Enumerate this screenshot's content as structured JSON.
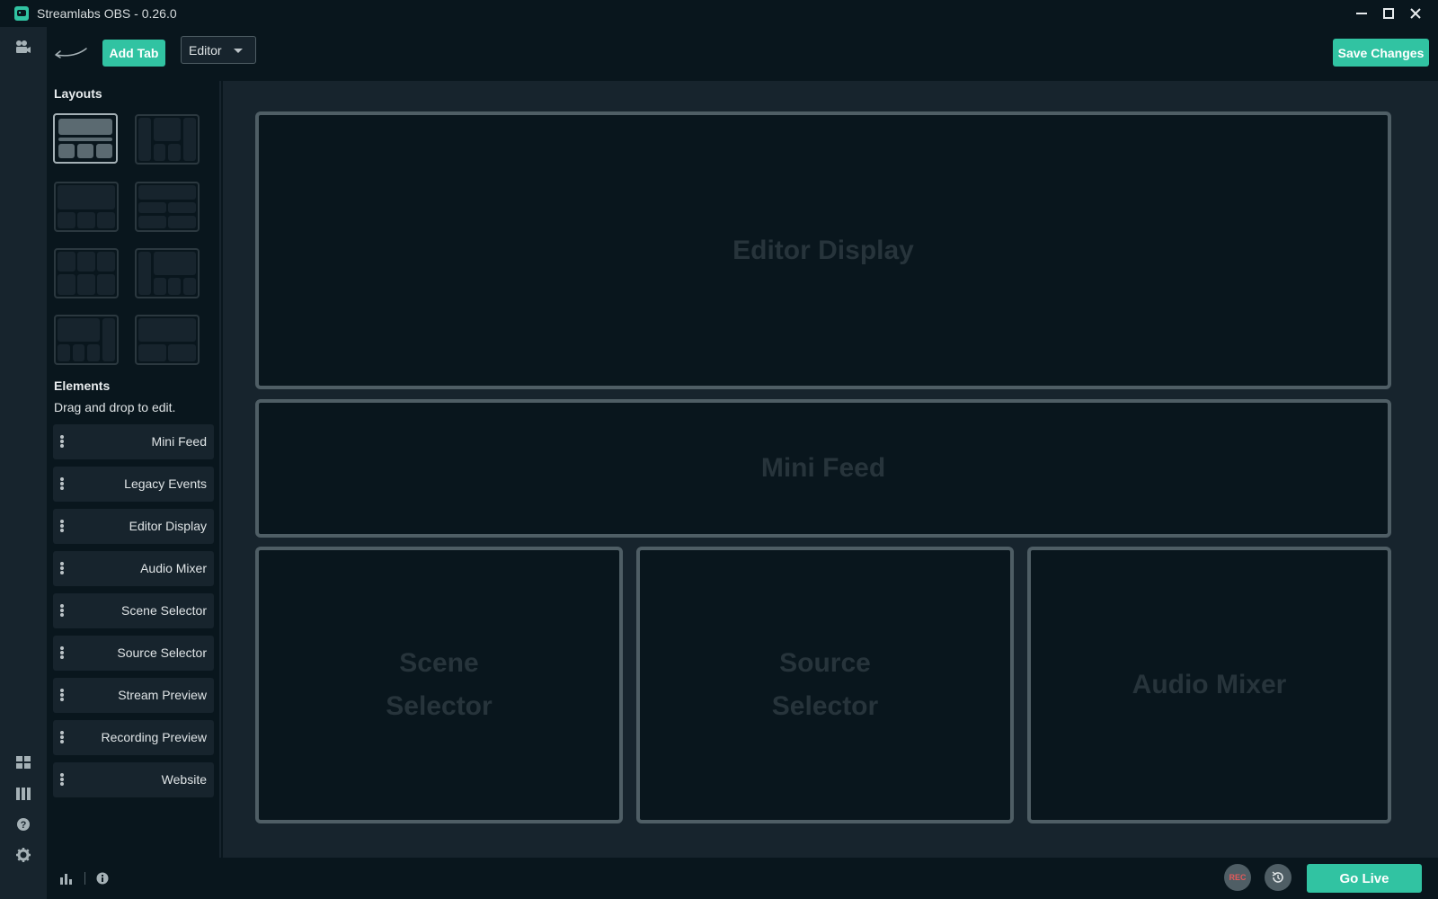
{
  "window": {
    "title": "Streamlabs OBS - 0.26.0"
  },
  "toolbar": {
    "add_tab_label": "Add Tab",
    "editor_select_value": "Editor",
    "save_changes_label": "Save Changes"
  },
  "sidebar": {
    "layouts_title": "Layouts",
    "elements_title": "Elements",
    "elements_hint": "Drag and drop to edit.",
    "elements": [
      {
        "label": "Mini Feed"
      },
      {
        "label": "Legacy Events"
      },
      {
        "label": "Editor Display"
      },
      {
        "label": "Audio Mixer"
      },
      {
        "label": "Scene Selector"
      },
      {
        "label": "Source Selector"
      },
      {
        "label": "Stream Preview"
      },
      {
        "label": "Recording Preview"
      },
      {
        "label": "Website"
      }
    ]
  },
  "canvas": {
    "slots": [
      {
        "label": "Editor Display"
      },
      {
        "label": "Mini Feed"
      },
      {
        "label": "Scene\nSelector"
      },
      {
        "label": "Source\nSelector"
      },
      {
        "label": "Audio Mixer"
      }
    ]
  },
  "footer": {
    "rec_label": "REC",
    "go_live_label": "Go Live"
  },
  "colors": {
    "accent": "#31c3a2",
    "background": "#09161d",
    "panel": "#17242d",
    "border": "#4f5e65",
    "rec_red": "#e35a5a"
  },
  "icons": {
    "app": "streamlabs-logo-icon",
    "nav_top": "studio-camera-icon",
    "nav_bottom": [
      "layout-grid-icon",
      "library-columns-icon",
      "help-icon",
      "settings-gear-icon"
    ],
    "footer_left": [
      "performance-chart-icon",
      "info-icon"
    ],
    "footer_right": [
      "rec-icon",
      "replay-buffer-icon"
    ]
  }
}
